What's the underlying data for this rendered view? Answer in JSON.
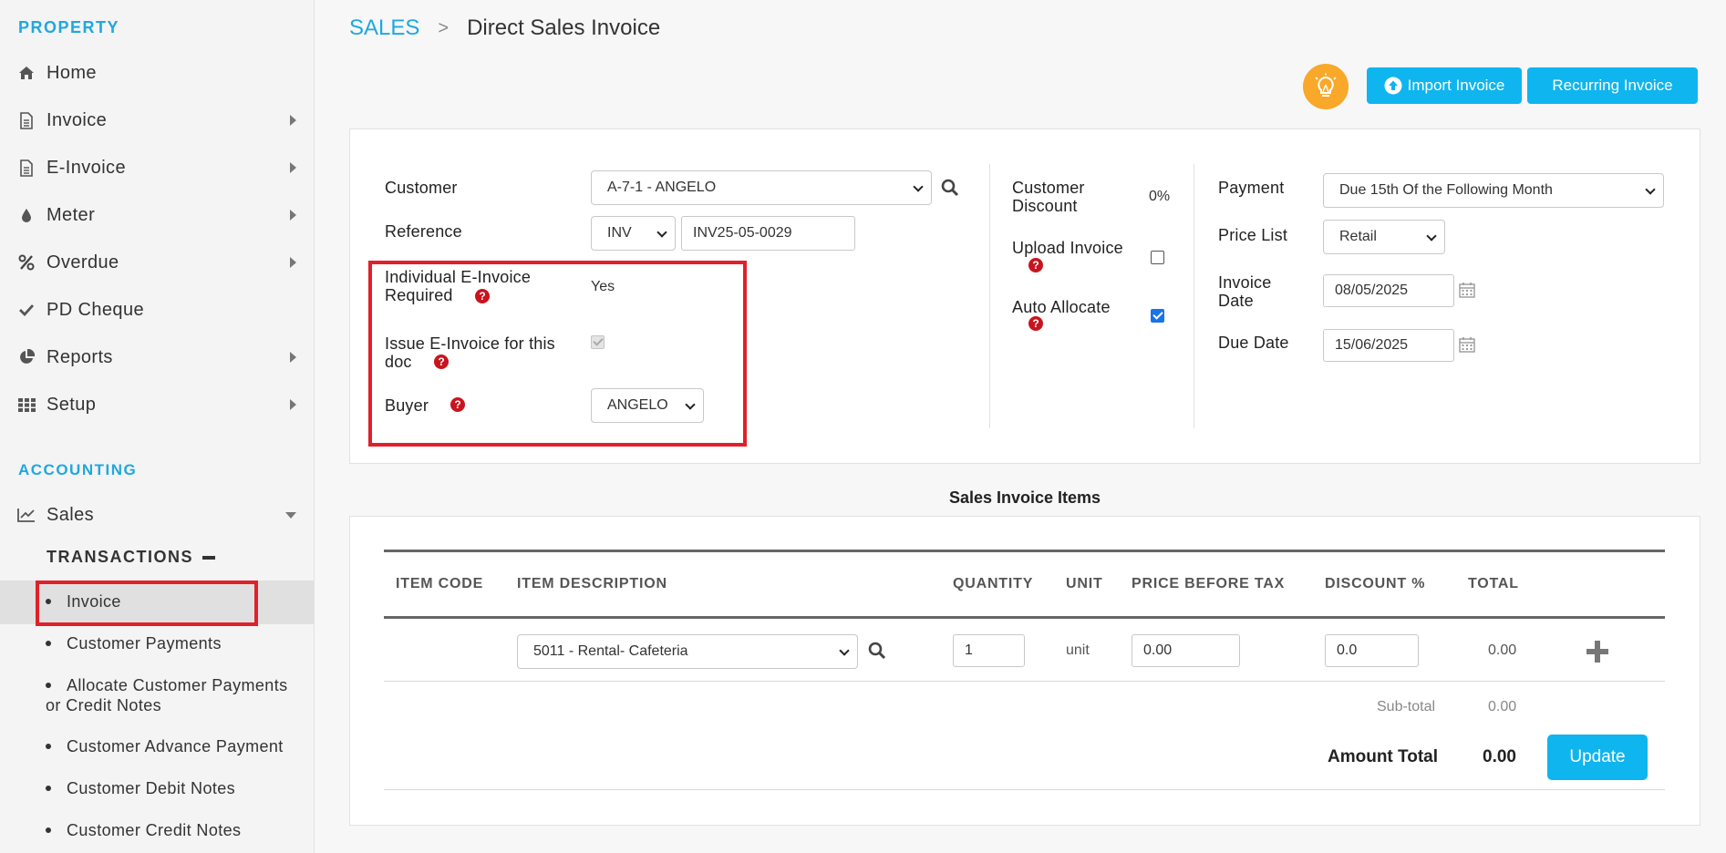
{
  "sidebar": {
    "property_title": "PROPERTY",
    "property_items": [
      {
        "label": "Home",
        "icon": "home-icon"
      },
      {
        "label": "Invoice",
        "icon": "document-icon"
      },
      {
        "label": "E-Invoice",
        "icon": "document-icon"
      },
      {
        "label": "Meter",
        "icon": "drop-icon"
      },
      {
        "label": "Overdue",
        "icon": "percent-icon"
      },
      {
        "label": "PD Cheque",
        "icon": "check-icon"
      },
      {
        "label": "Reports",
        "icon": "pie-chart-icon"
      },
      {
        "label": "Setup",
        "icon": "grid-icon"
      }
    ],
    "accounting_title": "ACCOUNTING",
    "sales_label": "Sales",
    "transactions_title": "TRANSACTIONS",
    "transaction_items": [
      "Invoice",
      "Customer Payments",
      "Allocate Customer Payments or Credit Notes",
      "Customer Advance Payment",
      "Customer Debit Notes",
      "Customer Credit Notes"
    ]
  },
  "breadcrumb": {
    "section": "SALES",
    "separator": ">",
    "page": "Direct Sales Invoice"
  },
  "toolbar": {
    "import_label": "Import Invoice",
    "recurring_label": "Recurring Invoice"
  },
  "form": {
    "customer_label": "Customer",
    "customer_value": "A-7-1 - ANGELO",
    "reference_label": "Reference",
    "reference_prefix": "INV",
    "reference_number": "INV25-05-0029",
    "individual_label_1": "Individual E-Invoice",
    "individual_label_2": "Required",
    "individual_value": "Yes",
    "issue_label_1": "Issue E-Invoice for this",
    "issue_label_2": "doc",
    "buyer_label": "Buyer",
    "buyer_value": "ANGELO",
    "discount_label_1": "Customer",
    "discount_label_2": "Discount",
    "discount_value": "0%",
    "upload_label": "Upload Invoice",
    "auto_allocate_label": "Auto Allocate",
    "payment_label": "Payment",
    "payment_value": "Due 15th Of the Following Month",
    "price_list_label": "Price List",
    "price_list_value": "Retail",
    "invoice_date_label_1": "Invoice",
    "invoice_date_label_2": "Date",
    "invoice_date_value": "08/05/2025",
    "due_date_label": "Due Date",
    "due_date_value": "15/06/2025"
  },
  "items": {
    "title": "Sales Invoice Items",
    "columns": [
      "ITEM CODE",
      "ITEM DESCRIPTION",
      "QUANTITY",
      "UNIT",
      "PRICE BEFORE TAX",
      "DISCOUNT %",
      "TOTAL"
    ],
    "row": {
      "description": "5011 - Rental- Cafeteria",
      "quantity": "1",
      "unit": "unit",
      "price": "0.00",
      "discount": "0.0",
      "total": "0.00"
    },
    "subtotal_label": "Sub-total",
    "subtotal_value": "0.00",
    "amount_total_label": "Amount Total",
    "amount_total_value": "0.00",
    "update_label": "Update"
  },
  "colors": {
    "accent": "#0fb5ee",
    "highlight": "#e0202a",
    "help": "#c8141e",
    "bulb": "#f9a82a"
  }
}
